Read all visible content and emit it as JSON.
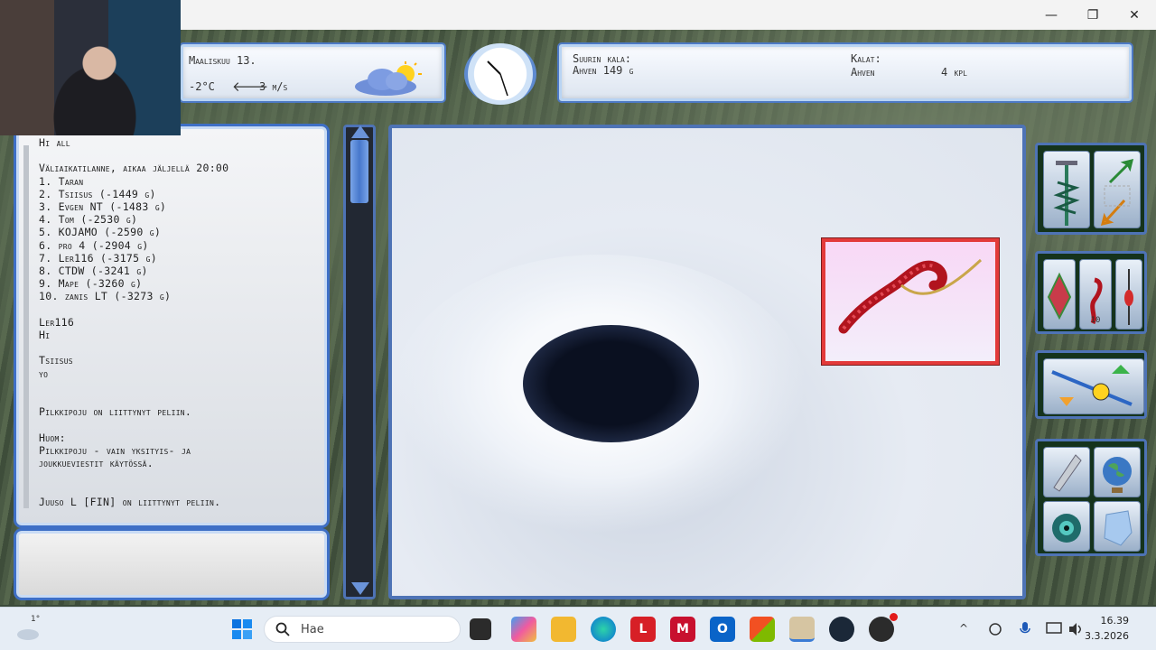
{
  "window": {
    "minimize": "—",
    "restore": "❐",
    "close": "✕"
  },
  "status": {
    "date": "Maaliskuu 13.",
    "temperature": "-2°C",
    "wind_arrow": "🡐",
    "wind": "3 m/s"
  },
  "biggest_fish": {
    "label": "Suurin kala:",
    "value": "Ahven 149 g"
  },
  "catches": {
    "label": "Kalat:",
    "species": "Ahven",
    "count": "4 kpl"
  },
  "chat": {
    "lines": [
      "Hi all",
      "",
      "Väliaikatilanne, aikaa jäljellä 20:00",
      "1. Taran",
      "2. Tsiisus (-1449 g)",
      "3. Evgen NT (-1483 g)",
      "4. Tom (-2530 g)",
      "5. KOJAMO (-2590 g)",
      "6. pro 4 (-2904 g)",
      "7. Ler116 (-3175 g)",
      "8. CTDW (-3241 g)",
      "9. Mape (-3260 g)",
      "10. zanis LT (-3273 g)",
      "",
      "Ler116",
      "Hi",
      "",
      "Tsiisus",
      "yo",
      "",
      "",
      "Pilkkipoju on liittynyt peliin.",
      "",
      "Huom:",
      "Pilkkipoju - vain yksityis- ja",
      "joukkueviestit käytössä.",
      "",
      "",
      "Juuso L [FIN] on liittynyt peliin."
    ]
  },
  "tools": {
    "lure_count": "10"
  },
  "taskbar": {
    "search_placeholder": "Hae",
    "weather_temp": "1°",
    "time": "16.39",
    "date": "3.3.2026",
    "icons": [
      "start-icon",
      "search-icon",
      "taskview-icon",
      "copilot-icon",
      "explorer-icon",
      "edge-icon",
      "lastpass-icon",
      "mcafee-icon",
      "outlook-icon",
      "store-icon",
      "game-icon",
      "steam-icon",
      "chatgpt-icon"
    ]
  }
}
